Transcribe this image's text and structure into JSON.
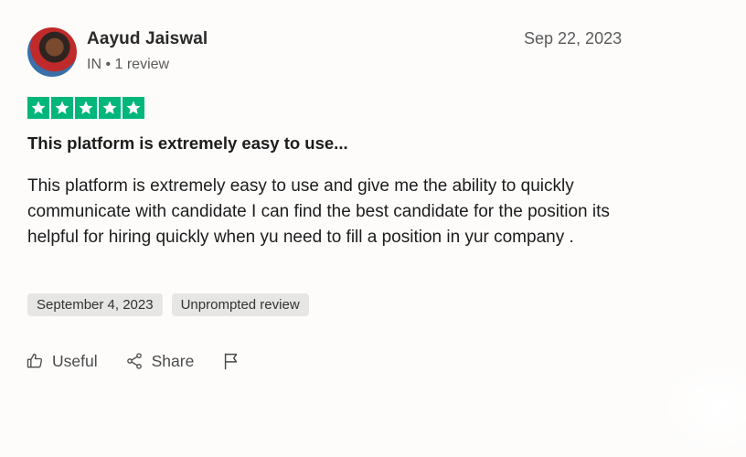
{
  "reviewer": {
    "name": "Aayud Jaiswal",
    "country": "IN",
    "separator": " • ",
    "review_count": "1 review"
  },
  "review": {
    "date": "Sep 22, 2023",
    "rating": 5,
    "rating_color": "#00b67a",
    "title": "This platform is extremely easy to use...",
    "body": "This platform is extremely easy to use and give me the ability to quickly communicate with candidate I can find the best candidate for the position its helpful for hiring quickly when yu need to fill a position in yur company .",
    "tags": [
      "September 4, 2023",
      "Unprompted review"
    ]
  },
  "actions": {
    "useful_label": "Useful",
    "useful_icon": "thumbs-up-icon",
    "share_label": "Share",
    "share_icon": "share-icon",
    "report_icon": "flag-icon"
  }
}
